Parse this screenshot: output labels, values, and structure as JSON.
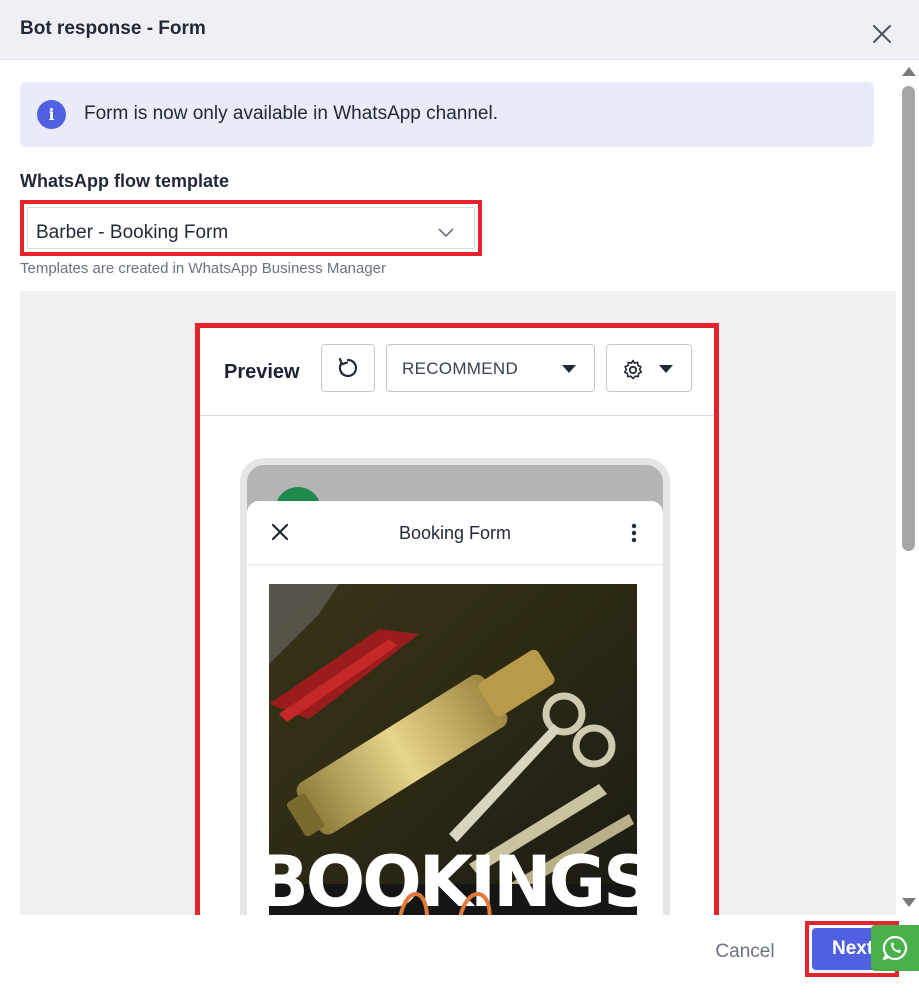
{
  "modal": {
    "title": "Bot response - Form"
  },
  "info_banner": {
    "icon": "info-icon",
    "icon_glyph": "i",
    "text": "Form is now only available in WhatsApp channel."
  },
  "template_field": {
    "label": "WhatsApp flow template",
    "value": "Barber - Booking Form",
    "helper": "Templates are created in WhatsApp Business Manager"
  },
  "preview": {
    "label": "Preview",
    "refresh_icon": "refresh-icon",
    "mode_value": "RECOMMEND",
    "settings_icon": "gear-icon",
    "sheet_title": "Booking Form",
    "image_text": "BOOKINGS"
  },
  "footer": {
    "cancel_label": "Cancel",
    "next_label": "Next"
  },
  "colors": {
    "accent": "#5160e0",
    "highlight": "#e4232c",
    "banner_bg": "#eaebfa",
    "whatsapp": "#4ab04a"
  }
}
